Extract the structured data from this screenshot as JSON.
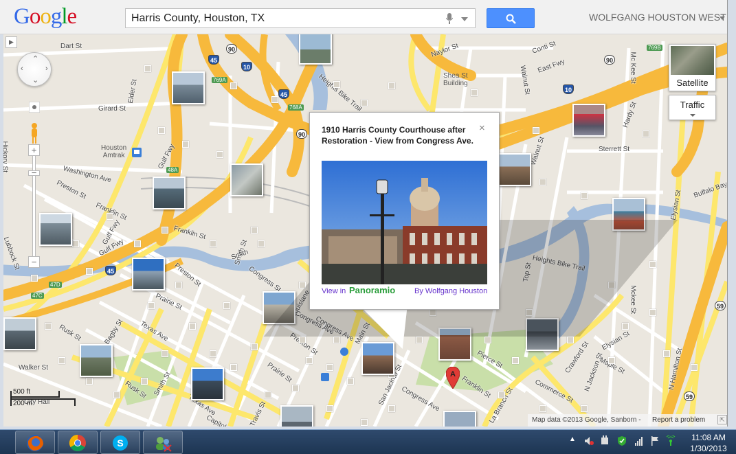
{
  "header": {
    "logo_text": "Google",
    "search_value": "Harris County, Houston, TX",
    "account_name": "WOLFGANG HOUSTON WEST"
  },
  "map": {
    "controls": {
      "satellite_label": "Satellite",
      "traffic_label": "Traffic"
    },
    "places": {
      "amtrak": "Houston\nAmtrak",
      "shea": "Shea St\nBuilding"
    },
    "streets": [
      {
        "name": "Dart St",
        "rot": 0
      },
      {
        "name": "Girard St",
        "rot": 0
      },
      {
        "name": "Washington Ave",
        "rot": 14
      },
      {
        "name": "Preston St",
        "rot": 28
      },
      {
        "name": "Franklin St",
        "rot": 24
      },
      {
        "name": "Gulf Fwy",
        "rot": -62
      },
      {
        "name": "Franklin St",
        "rot": 16
      },
      {
        "name": "Preston St",
        "rot": 40
      },
      {
        "name": "Congress St",
        "rot": 36
      },
      {
        "name": "Gulf Fwy",
        "rot": -30
      },
      {
        "name": "Prairie St",
        "rot": 26
      },
      {
        "name": "Rusk St",
        "rot": 32
      },
      {
        "name": "Bagby St",
        "rot": -58
      },
      {
        "name": "Texas Ave",
        "rot": 32
      },
      {
        "name": "Walker St",
        "rot": 0
      },
      {
        "name": "Rusk St",
        "rot": 36
      },
      {
        "name": "Smith St",
        "rot": -60
      },
      {
        "name": "Texas Ave",
        "rot": 34
      },
      {
        "name": "Capitol St",
        "rot": 30
      },
      {
        "name": "Travis St",
        "rot": -64
      },
      {
        "name": "Prairie St",
        "rot": 36
      },
      {
        "name": "Preston St",
        "rot": 36
      },
      {
        "name": "Congress Ave",
        "rot": 28
      },
      {
        "name": "Main St",
        "rot": -62
      },
      {
        "name": "San Jacinto St",
        "rot": -64
      },
      {
        "name": "Congress Ave",
        "rot": 30
      },
      {
        "name": "Franklin St",
        "rot": 34
      },
      {
        "name": "La Branch St",
        "rot": -60
      },
      {
        "name": "Commerce St",
        "rot": 28
      },
      {
        "name": "Crawford St",
        "rot": -56
      },
      {
        "name": "N Jackson St",
        "rot": -70
      },
      {
        "name": "Elysian St",
        "rot": -30
      },
      {
        "name": "Maple St",
        "rot": 28
      },
      {
        "name": "N Hamilton St",
        "rot": -78
      },
      {
        "name": "Heights Bike Trail",
        "rot": 40
      },
      {
        "name": "Heights Bike Trail",
        "rot": 12
      },
      {
        "name": "Naylor St",
        "rot": -20
      },
      {
        "name": "Conti St",
        "rot": -20
      },
      {
        "name": "East Fwy",
        "rot": -20
      },
      {
        "name": "Walnut St",
        "rot": 80
      },
      {
        "name": "Mc Kee St",
        "rot": 90
      },
      {
        "name": "Hardy St",
        "rot": -70
      },
      {
        "name": "Sterrett St",
        "rot": 0
      },
      {
        "name": "Elysian St",
        "rot": -80
      },
      {
        "name": "Buffalo Bayou Hike",
        "rot": -20
      },
      {
        "name": "Mckee St",
        "rot": 90
      },
      {
        "name": "Top St",
        "rot": -80
      },
      {
        "name": "Walnut St",
        "rot": -72
      },
      {
        "name": "Elder St",
        "rot": -80
      },
      {
        "name": "Hickory St",
        "rot": 90
      },
      {
        "name": "Artesian",
        "rot": 90
      },
      {
        "name": "Lubbock St",
        "rot": 70
      },
      {
        "name": "Gulf Fwy",
        "rot": -60
      },
      {
        "name": "Smith",
        "rot": -20
      },
      {
        "name": "Smith St",
        "rot": -72
      },
      {
        "name": "Louisiane",
        "rot": -60
      },
      {
        "name": "Congress Ave",
        "rot": 30
      },
      {
        "name": "City Hall",
        "rot": 0
      },
      {
        "name": "Pierce St",
        "rot": 30
      }
    ],
    "highway_shields": [
      "45",
      "90",
      "10",
      "45",
      "90",
      "10",
      "90",
      "59",
      "59",
      "45"
    ],
    "highway_labels": [
      "769A",
      "768A",
      "48A",
      "47D",
      "47C",
      "769B"
    ]
  },
  "infowindow": {
    "title": "1910 Harris County Courthouse after Restoration - View from Congress Ave.",
    "close_glyph": "×",
    "view_in": "View in",
    "brand": "Panoramio",
    "byline": "By Wolfgang Houston"
  },
  "marker": {
    "label": "A"
  },
  "scale": {
    "feet": "500 ft",
    "meters": "200 m"
  },
  "footer": {
    "attribution": "Map data ©2013 Google, Sanborn -",
    "report": "Report a problem"
  },
  "taskbar": {
    "time": "11:08 AM",
    "date": "1/30/2013",
    "apps": [
      "firefox",
      "chrome",
      "skype",
      "network-users"
    ]
  },
  "colors": {
    "highway": "#f7b93c",
    "arterial": "#fde76c",
    "water": "#a6bfdd",
    "park": "#c9dfa9",
    "map_bg": "#ebe7df"
  }
}
